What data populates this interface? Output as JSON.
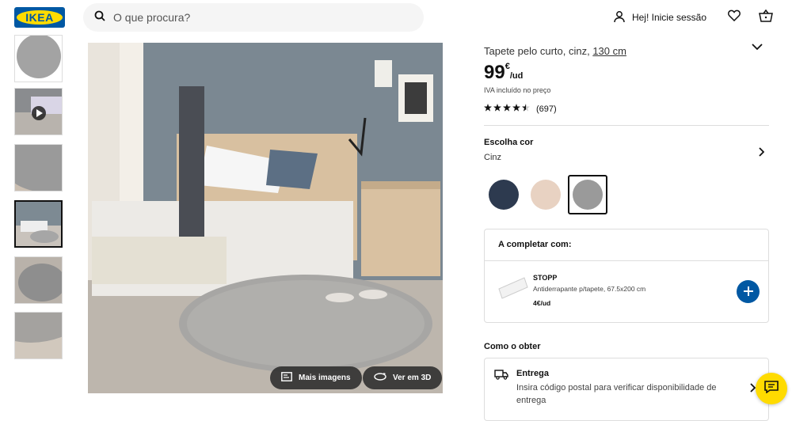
{
  "header": {
    "logo_text": "IKEA",
    "search_placeholder": "O que procura?",
    "login_label": "Hej! Inicie sessão",
    "brand_blue": "#0058a3",
    "brand_yellow": "#ffdb00"
  },
  "gallery": {
    "thumbnails": [
      {
        "name": "rug-top-view"
      },
      {
        "name": "video-bedroom"
      },
      {
        "name": "rug-closeup-edge"
      },
      {
        "name": "bedroom-scene",
        "active": true
      },
      {
        "name": "rug-angle"
      },
      {
        "name": "rug-texture"
      }
    ],
    "more_images_label": "Mais imagens",
    "view_3d_label": "Ver em 3D"
  },
  "product": {
    "title": "Tapete pelo curto, cinz,",
    "size_link": "130 cm",
    "price_integer": "99",
    "price_currency": "€",
    "price_unit": "/ud",
    "vat_note": "IVA incluído no preço",
    "rating_value": 4.5,
    "review_count": "(697)"
  },
  "color_chooser": {
    "title": "Escolha cor",
    "selected": "Cinz",
    "swatches": [
      {
        "name": "dark-blue",
        "color": "#2d3a4f"
      },
      {
        "name": "beige",
        "color": "#e8d2c2"
      },
      {
        "name": "grey",
        "color": "#9a9a9a",
        "selected": true
      }
    ]
  },
  "complete_with": {
    "title": "A completar com:",
    "item_name": "STOPP",
    "item_desc": "Antiderrapante p/tapete, 67.5x200 cm",
    "item_price": "4€/ud"
  },
  "obtain": {
    "title": "Como o obter",
    "delivery_title": "Entrega",
    "delivery_desc": "Insira código postal para verificar disponibilidade de entrega"
  }
}
